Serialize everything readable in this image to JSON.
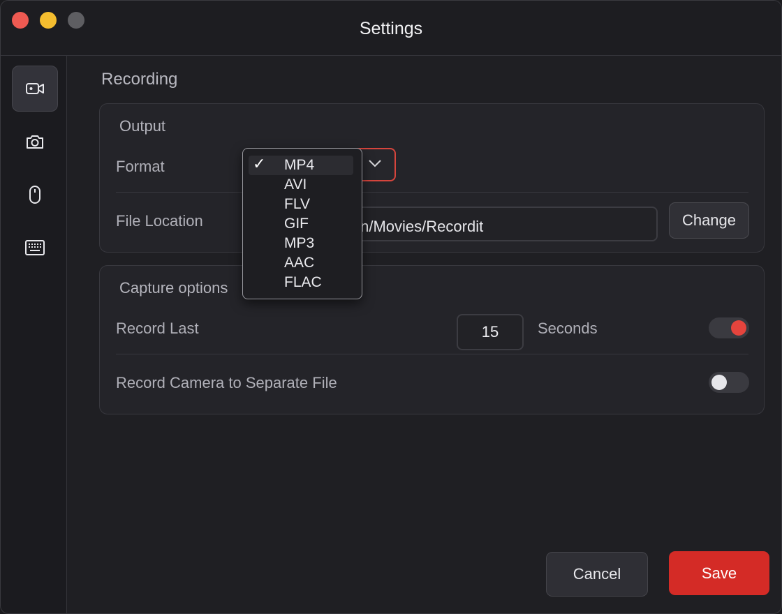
{
  "window": {
    "title": "Settings"
  },
  "sidebar": {
    "items": [
      {
        "name": "Recording",
        "icon": "video-camera-icon",
        "active": true
      },
      {
        "name": "Screenshot",
        "icon": "camera-icon",
        "active": false
      },
      {
        "name": "Mouse",
        "icon": "mouse-icon",
        "active": false
      },
      {
        "name": "Keyboard",
        "icon": "keyboard-icon",
        "active": false
      }
    ]
  },
  "main": {
    "section_title": "Recording",
    "output": {
      "title": "Output",
      "format_label": "Format",
      "format_value": "MP4",
      "file_location_label": "File Location",
      "file_location_value": "lan/Movies/Recordit",
      "change_label": "Change"
    },
    "capture": {
      "title": "Capture options",
      "record_last_label": "Record Last",
      "record_last_value": "15",
      "seconds_label": "Seconds",
      "record_last_enabled": true,
      "camera_label": "Record Camera to Separate File",
      "camera_enabled": false
    }
  },
  "dropdown": {
    "options": [
      "MP4",
      "AVI",
      "FLV",
      "GIF",
      "MP3",
      "AAC",
      "FLAC"
    ],
    "selected": "MP4",
    "check_glyph": "✓"
  },
  "footer": {
    "cancel_label": "Cancel",
    "save_label": "Save"
  },
  "colors": {
    "accent": "#d42b26",
    "toggle_on_knob": "#e5443d",
    "toggle_off_knob": "#e6e6ea"
  }
}
